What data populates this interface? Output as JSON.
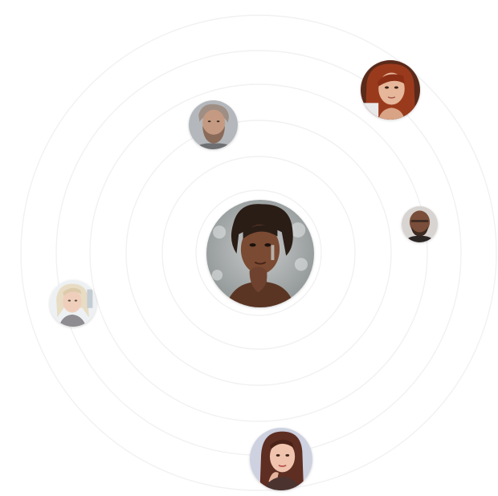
{
  "palette": {
    "background": "#ffffff",
    "orbit_ring": "#f1f1f1"
  },
  "avatars": [
    {
      "id": "center",
      "icon": "woman-portrait-center",
      "role": "focused"
    },
    {
      "id": "top-right",
      "icon": "woman-red-hair-portrait"
    },
    {
      "id": "upper-left",
      "icon": "bearded-man-portrait"
    },
    {
      "id": "right",
      "icon": "bald-man-portrait"
    },
    {
      "id": "left",
      "icon": "blonde-woman-portrait"
    },
    {
      "id": "bottom",
      "icon": "brunette-woman-portrait"
    }
  ]
}
